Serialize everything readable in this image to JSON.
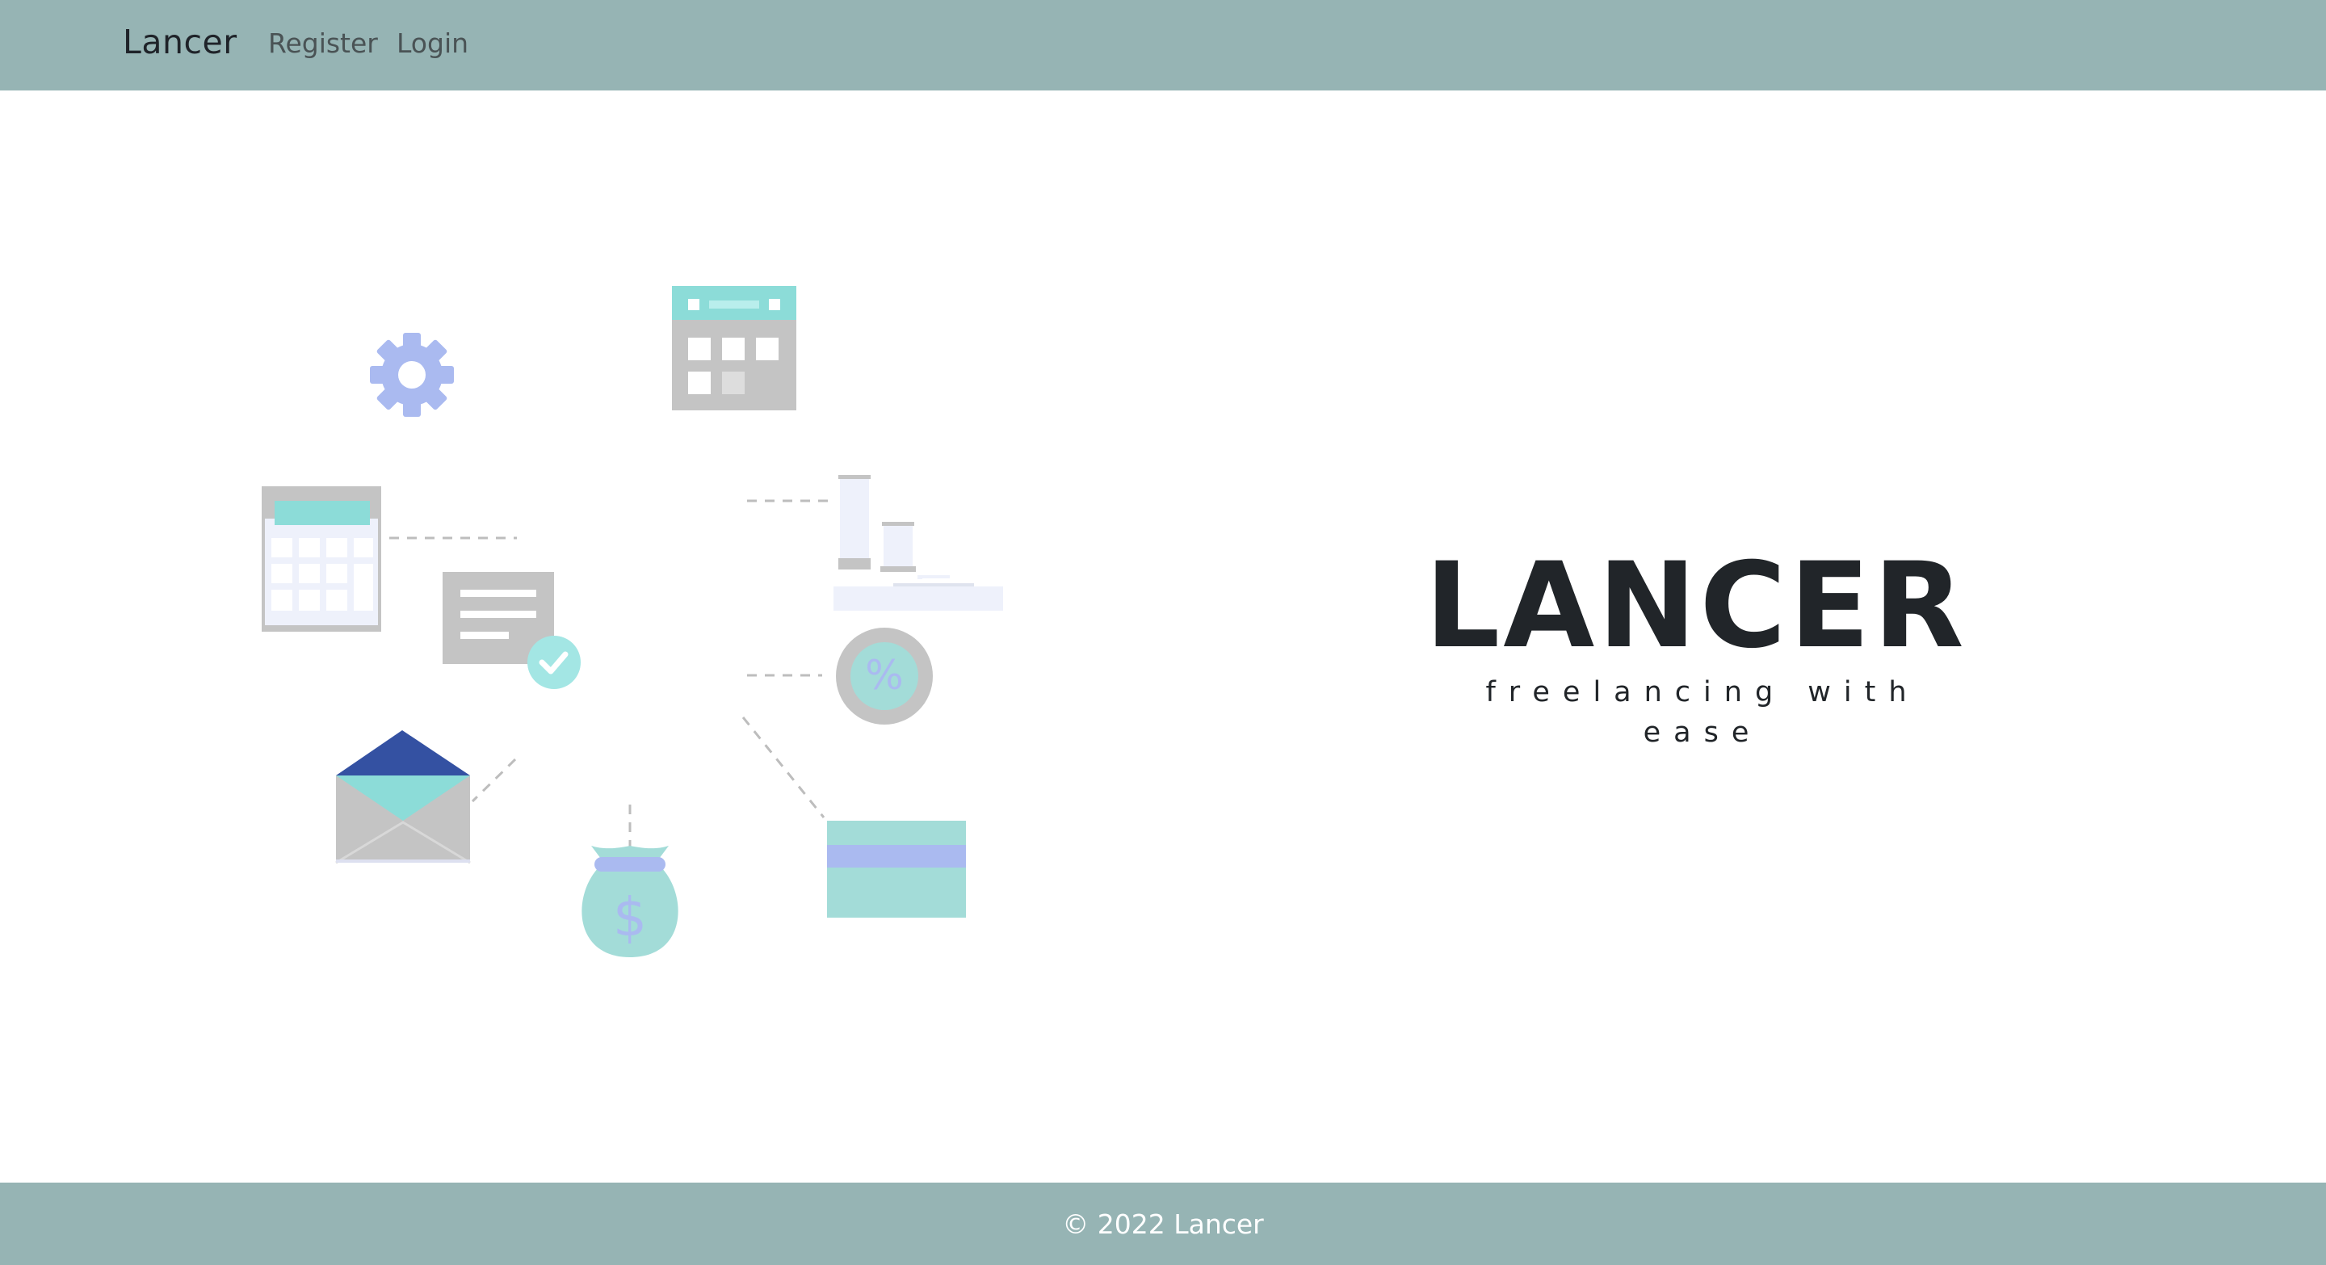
{
  "nav": {
    "brand": "Lancer",
    "links": [
      {
        "label": "Register"
      },
      {
        "label": "Login"
      }
    ]
  },
  "hero": {
    "title": "LANCER",
    "tagline": "freelancing with ease"
  },
  "footer": {
    "text": "© 2022 Lancer"
  },
  "colors": {
    "nav_bg": "#96b4b4",
    "footer_bg": "#96b4b4",
    "teal": "#8cdcd8",
    "mint": "#a3dcd8",
    "periwinkle": "#aabaf0",
    "navy": "#3451a2",
    "gray": "#c4c4c4",
    "heading": "#212529"
  },
  "illustration": {
    "icons": [
      "gear-icon",
      "calendar-icon",
      "calculator-icon",
      "document-check-icon",
      "chart-bars-icon",
      "percent-coin-icon",
      "envelope-icon",
      "money-bag-icon",
      "credit-card-icon"
    ]
  }
}
